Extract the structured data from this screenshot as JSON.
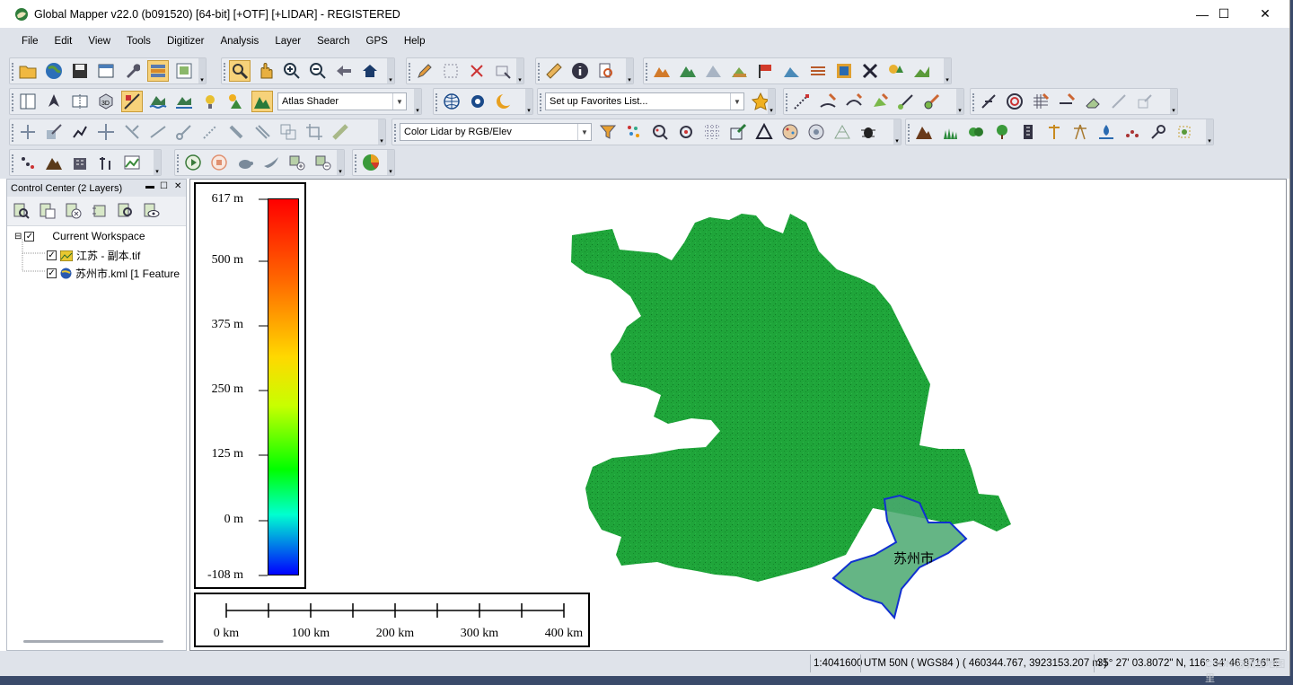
{
  "window": {
    "title": "Global Mapper v22.0 (b091520) [64-bit] [+OTF] [+LIDAR] - REGISTERED",
    "minimize": "—",
    "maximize": "☐",
    "close": "✕"
  },
  "menu": [
    "File",
    "Edit",
    "View",
    "Tools",
    "Digitizer",
    "Analysis",
    "Layer",
    "Search",
    "GPS",
    "Help"
  ],
  "toolbar": {
    "shader_select": "Atlas Shader",
    "favorites_select": "Set up Favorites List...",
    "lidar_color_select": "Color Lidar by RGB/Elev"
  },
  "control_center": {
    "title": "Control Center (2 Layers)",
    "workspace": "Current Workspace",
    "layers": [
      "江苏 - 副本.tif",
      "苏州市.kml [1 Feature"
    ]
  },
  "map": {
    "city_label": "苏州市",
    "legend": {
      "labels": [
        "617 m",
        "500 m",
        "375 m",
        "250 m",
        "125 m",
        "0 m",
        "-108 m"
      ]
    },
    "scale": {
      "labels": [
        "0 km",
        "100 km",
        "200 km",
        "300 km",
        "400 km"
      ]
    }
  },
  "status": {
    "scale": "1:4041600",
    "projection": "UTM 50N ( WGS84 ) ( 460344.767, 3923153.207 m )",
    "latlon": "35° 27' 03.8072\" N, 116° 34' 46.8716\" E",
    "watermark": "CSDN @我在地图里"
  },
  "colors": {
    "accent": "#f7d27a",
    "terrain": "#1fa53a",
    "kml_outline": "#1030d0"
  }
}
